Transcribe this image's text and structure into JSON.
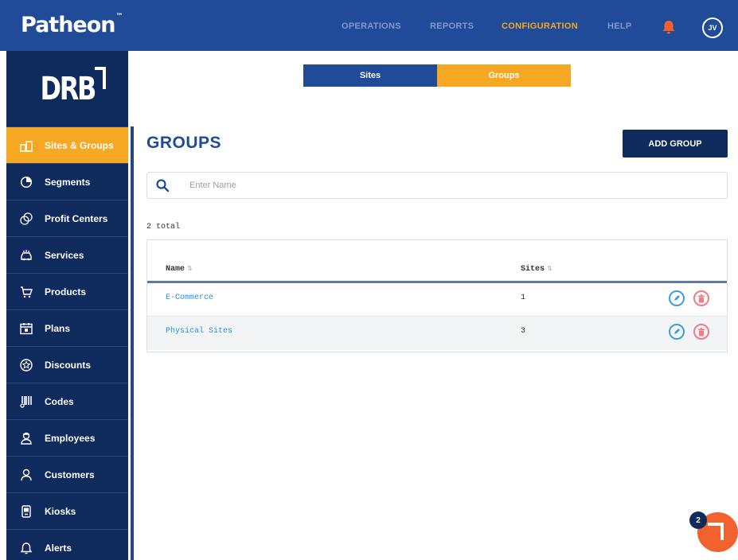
{
  "brand": {
    "name": "Patheon",
    "tm": "™"
  },
  "topnav": {
    "items": [
      {
        "label": "OPERATIONS"
      },
      {
        "label": "REPORTS"
      },
      {
        "label": "CONFIGURATION",
        "active": true
      },
      {
        "label": "HELP"
      }
    ],
    "user_initials": "JV",
    "accent_color": "#f7a823",
    "bar_color": "#1f4b99"
  },
  "sidebar": {
    "logo": "DRB",
    "items": [
      {
        "label": "Sites & Groups",
        "icon": "building-icon",
        "active": true
      },
      {
        "label": "Segments",
        "icon": "pie-chart-icon"
      },
      {
        "label": "Profit Centers",
        "icon": "coins-icon"
      },
      {
        "label": "Services",
        "icon": "car-wash-icon"
      },
      {
        "label": "Products",
        "icon": "cart-icon"
      },
      {
        "label": "Plans",
        "icon": "calendar-icon"
      },
      {
        "label": "Discounts",
        "icon": "star-badge-icon"
      },
      {
        "label": "Codes",
        "icon": "barcode-icon"
      },
      {
        "label": "Employees",
        "icon": "employee-icon"
      },
      {
        "label": "Customers",
        "icon": "customer-icon"
      },
      {
        "label": "Kiosks",
        "icon": "kiosk-icon"
      },
      {
        "label": "Alerts",
        "icon": "alert-icon"
      }
    ]
  },
  "tabs": {
    "sites": "Sites",
    "groups": "Groups",
    "active": "Groups"
  },
  "main": {
    "title": "GROUPS",
    "add_button": "ADD GROUP",
    "search_placeholder": "Enter Name",
    "total": "2 total"
  },
  "table": {
    "columns": {
      "name": "Name",
      "sites": "Sites"
    },
    "rows": [
      {
        "name": "E-Commerce",
        "sites": "1"
      },
      {
        "name": "Physical Sites",
        "sites": "3"
      }
    ]
  },
  "chat": {
    "badge": "2"
  }
}
